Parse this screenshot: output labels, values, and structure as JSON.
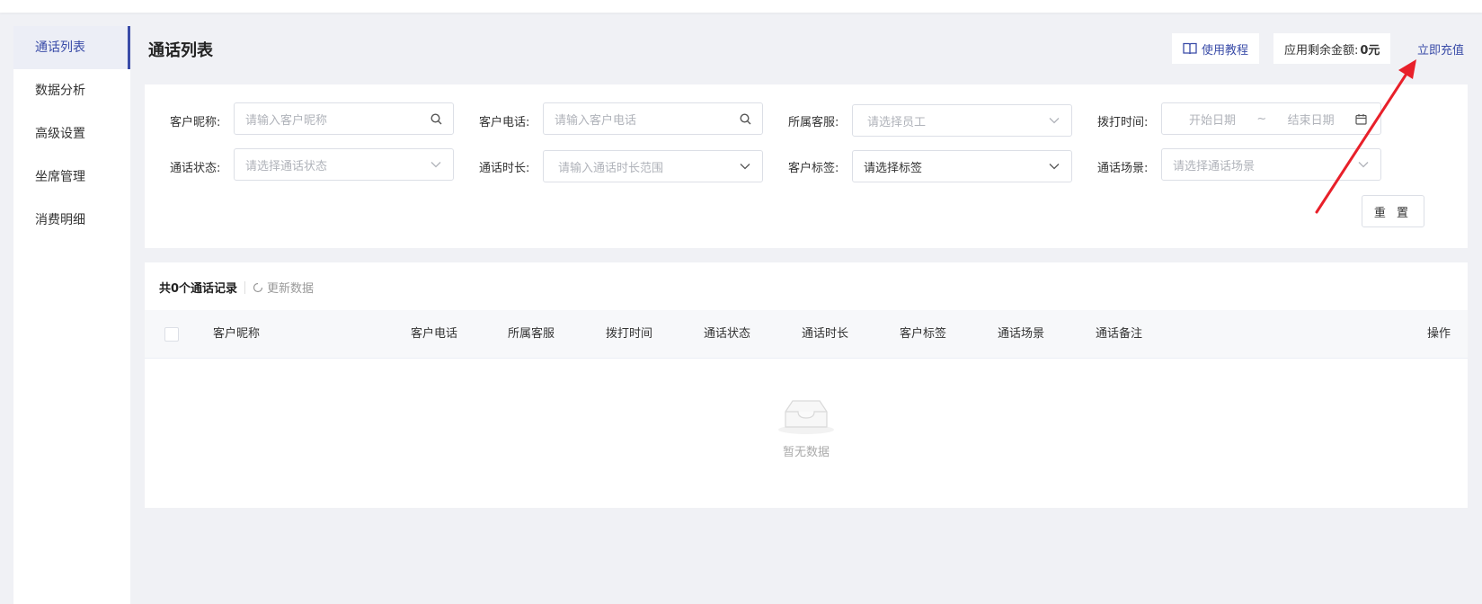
{
  "sidebar": {
    "items": [
      {
        "label": "通话列表",
        "active": true
      },
      {
        "label": "数据分析"
      },
      {
        "label": "高级设置"
      },
      {
        "label": "坐席管理"
      },
      {
        "label": "消费明细"
      }
    ]
  },
  "header": {
    "title": "通话列表",
    "tutorial_label": "使用教程",
    "balance_label": "应用剩余金额:",
    "balance_value": "0元",
    "recharge_label": "立即充值"
  },
  "filters": {
    "nickname": {
      "label": "客户昵称:",
      "placeholder": "请输入客户昵称",
      "icon": "search-icon"
    },
    "phone": {
      "label": "客户电话:",
      "placeholder": "请输入客户电话",
      "icon": "search-icon"
    },
    "service": {
      "label": "所属客服:",
      "placeholder": "请选择员工",
      "icon": "chevron-down-icon"
    },
    "dial_time": {
      "label": "拨打时间:",
      "start_placeholder": "开始日期",
      "separator": "~",
      "end_placeholder": "结束日期",
      "icon": "calendar-icon"
    },
    "status": {
      "label": "通话状态:",
      "placeholder": "请选择通话状态",
      "icon": "chevron-down-icon"
    },
    "duration": {
      "label": "通话时长:",
      "placeholder": "请输入通话时长范围",
      "icon": "chevron-down-icon"
    },
    "tag": {
      "label": "客户标签:",
      "value": "请选择标签",
      "icon": "chevron-down-icon"
    },
    "scene": {
      "label": "通话场景:",
      "placeholder": "请选择通话场景",
      "icon": "chevron-down-icon"
    },
    "reset_label": "重 置"
  },
  "table": {
    "summary": "共0个通话记录",
    "refresh_label": "更新数据",
    "columns": [
      "客户昵称",
      "客户电话",
      "所属客服",
      "拨打时间",
      "通话状态",
      "通话时长",
      "客户标签",
      "通话场景",
      "通话备注",
      "操作"
    ],
    "empty_text": "暂无数据"
  },
  "colors": {
    "accent": "#3a4ca8",
    "annotation_arrow": "#e8202a",
    "background": "#f0f1f5"
  }
}
